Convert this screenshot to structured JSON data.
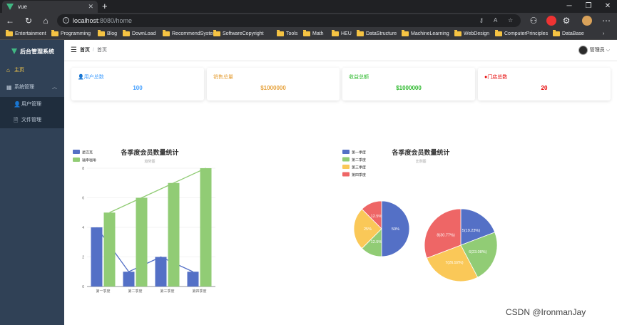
{
  "browser": {
    "tab_title": "vue",
    "address": "localhost",
    "address_path": ":8080/home",
    "bookmarks": [
      "Entertainment",
      "Programming",
      "Blog",
      "DownLoad",
      "RecommendSystem",
      "SoftwareCopyright",
      "Tools",
      "Math",
      "HEU",
      "DataStructure",
      "MachineLearning",
      "WebDesign",
      "ComputerPrinciples",
      "DataBase"
    ]
  },
  "sidebar": {
    "title": "后台管理系统",
    "items": [
      {
        "label": "主页",
        "icon": "home-icon"
      },
      {
        "label": "系统管理",
        "icon": "grid-icon"
      },
      {
        "label": "用户管理",
        "icon": "user-icon"
      },
      {
        "label": "文件管理",
        "icon": "document-icon"
      }
    ]
  },
  "header": {
    "breadcrumb_home": "首页",
    "breadcrumb_sep": "/",
    "breadcrumb_current": "首页",
    "user": "管理员"
  },
  "stats": [
    {
      "label": "用户总数",
      "value": "100",
      "color": "#409eff",
      "icon": "user-icon"
    },
    {
      "label": "销售总量",
      "value": "$1000000",
      "color": "#e6a23c"
    },
    {
      "label": "收益总额",
      "value": "$1000000",
      "color": "#2ab82a"
    },
    {
      "label": "门店总数",
      "value": "20",
      "color": "#e60000",
      "icon": "store-icon"
    }
  ],
  "chart_data": [
    {
      "type": "bar",
      "title": "各季度会员数量统计",
      "subtitle": "趋势图",
      "categories": [
        "第一季度",
        "第二季度",
        "第三季度",
        "第四季度"
      ],
      "ylim": [
        0,
        8
      ],
      "yticks": [
        0,
        2,
        4,
        6,
        8
      ],
      "legend_position": "top-left",
      "series": [
        {
          "name": "星巴克",
          "type": "bar+line",
          "values": [
            4,
            1,
            2,
            1
          ],
          "color": "#5470c6"
        },
        {
          "name": "瑞幸咖啡",
          "type": "bar+line",
          "values": [
            5,
            6,
            7,
            8
          ],
          "color": "#91cc75"
        }
      ]
    },
    {
      "type": "pie",
      "title": "各季度会员数量统计",
      "subtitle": "比例图",
      "legend_position": "top-left",
      "legend": [
        "第一季度",
        "第二季度",
        "第三季度",
        "第四季度"
      ],
      "colors": [
        "#5470c6",
        "#91cc75",
        "#fac858",
        "#ee6666"
      ],
      "pies": [
        {
          "values": [
            4,
            1,
            2,
            1
          ],
          "labels": [
            "50%",
            "12.5%",
            "25%",
            "12.5%"
          ]
        },
        {
          "values": [
            5,
            6,
            7,
            8
          ],
          "labels": [
            "5(19.23%)",
            "6(23.08%)",
            "7(26.92%)",
            "8(30.77%)"
          ]
        }
      ]
    }
  ],
  "watermark": "CSDN @IronmanJay"
}
